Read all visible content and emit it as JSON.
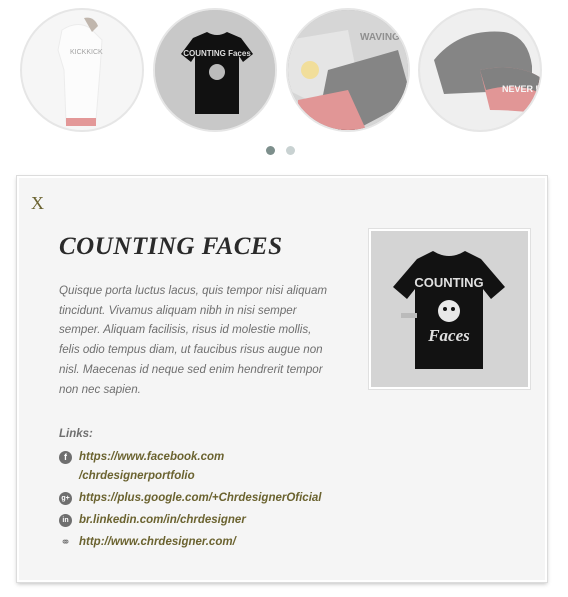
{
  "carousel": {
    "items": [
      {
        "name": "kickkick-tee",
        "print": "KICKKICK"
      },
      {
        "name": "counting-faces-tee",
        "print": "COUNTING Faces"
      },
      {
        "name": "waving-hoodie",
        "print": "WAVING HOO T-S"
      },
      {
        "name": "never-broke-cap",
        "print": "NEVER BROKE"
      }
    ],
    "active_index": 1,
    "pages": 2,
    "current_page": 0
  },
  "detail": {
    "close_label": "X",
    "title": "COUNTING FACES",
    "description": "Quisque porta luctus lacus, quis tempor nisi aliquam tincidunt. Vivamus aliquam nibh in nisi semper semper. Aliquam facilisis, risus id molestie mollis, felis odio tempus diam, ut faucibus risus augue non nisl. Maecenas id neque sed enim hendrerit tempor non nec sapien.",
    "product_print_top": "COUNTING",
    "product_print_bottom": "Faces",
    "links_label": "Links:",
    "links": [
      {
        "icon": "facebook-icon",
        "glyph": "f",
        "text": "https://www.facebook.com /chrdesignerportfolio"
      },
      {
        "icon": "google-plus-icon",
        "glyph": "g+",
        "text": "https://plus.google.com/+ChrdesignerOficial"
      },
      {
        "icon": "linkedin-icon",
        "glyph": "in",
        "text": "br.linkedin.com/in/chrdesigner"
      },
      {
        "icon": "link-icon",
        "glyph": "⚭",
        "text": "http://www.chrdesigner.com/"
      }
    ]
  },
  "colors": {
    "accent_link": "#6b6330",
    "active_dot": "#7d8f8c",
    "inactive_dot": "#c9d2d2",
    "title": "#2a2a2a",
    "body_text": "#6f6f6f"
  }
}
